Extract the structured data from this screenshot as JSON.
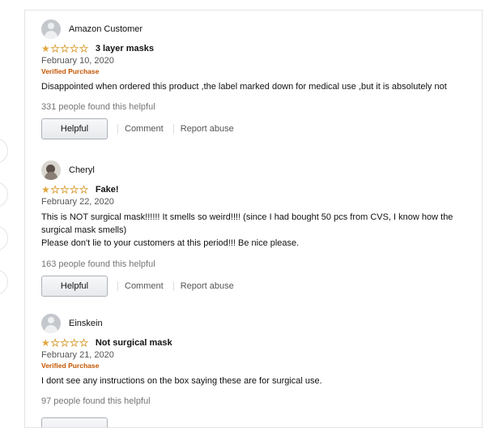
{
  "reviews": [
    {
      "reviewer": "Amazon Customer",
      "avatar": "default-avatar",
      "rating": 1,
      "max_rating": 5,
      "title": "3 layer masks",
      "date": "February 10, 2020",
      "verified": "Verified Purchase",
      "body": "Disappointed when ordered this product ,the label marked down for medical use ,but it is absolutely not",
      "helpful_count": "331 people found this helpful",
      "helpful_label": "Helpful",
      "comment_label": "Comment",
      "report_label": "Report abuse"
    },
    {
      "reviewer": "Cheryl",
      "avatar": "photo-avatar",
      "rating": 1,
      "max_rating": 5,
      "title": "Fake!",
      "date": "February 22, 2020",
      "verified": "",
      "body": "This is NOT surgical mask!!!!!! It smells so weird!!!! (since I had bought 50 pcs from CVS, I know how the surgical mask smells)",
      "body2": "Please don't lie to your customers at this period!!! Be nice please.",
      "helpful_count": "163 people found this helpful",
      "helpful_label": "Helpful",
      "comment_label": "Comment",
      "report_label": "Report abuse"
    },
    {
      "reviewer": "Einskein",
      "avatar": "default-avatar",
      "rating": 1,
      "max_rating": 5,
      "title": "Not surgical mask",
      "date": "February 21, 2020",
      "verified": "Verified Purchase",
      "body": "I dont see any instructions on the box saying these are for surgical use.",
      "helpful_count": "97 people found this helpful"
    }
  ],
  "colors": {
    "star": "#e2a53b",
    "verified": "#c45500",
    "muted": "#767676"
  }
}
